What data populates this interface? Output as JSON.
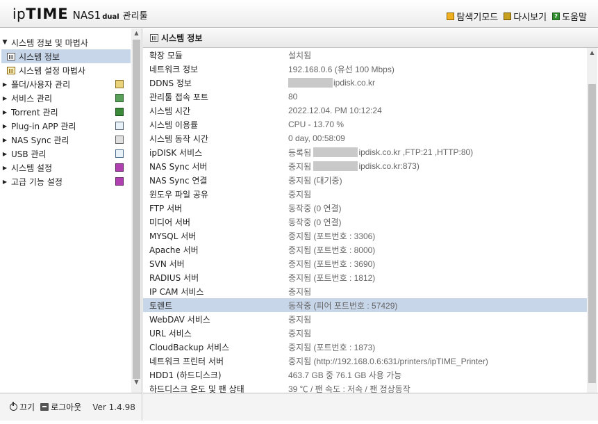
{
  "header": {
    "logo_ip": "ip",
    "logo_time": "TIME",
    "logo_model": "NAS1",
    "logo_dual": "dual",
    "logo_tool": "관리툴",
    "links": [
      {
        "label": "탐색기모드",
        "icon": "explorer-mode-icon"
      },
      {
        "label": "다시보기",
        "icon": "refresh-icon"
      },
      {
        "label": "도움말",
        "icon": "help-icon"
      }
    ]
  },
  "sidebar": {
    "items": [
      {
        "label": "시스템 정보 및 마법사",
        "expanded": true,
        "level": 0
      },
      {
        "label": "시스템 정보",
        "level": 1,
        "selected": true
      },
      {
        "label": "시스템 설정 마법사",
        "level": 1
      },
      {
        "label": "폴더/사용자 관리",
        "level": 0,
        "icon": "folder-user-icon"
      },
      {
        "label": "서비스 관리",
        "level": 0,
        "icon": "service-icon"
      },
      {
        "label": "Torrent 관리",
        "level": 0,
        "icon": "torrent-icon"
      },
      {
        "label": "Plug-in APP 관리",
        "level": 0,
        "icon": "plugin-icon"
      },
      {
        "label": "NAS Sync 관리",
        "level": 0,
        "icon": "nas-sync-icon"
      },
      {
        "label": "USB 관리",
        "level": 0,
        "icon": "usb-icon"
      },
      {
        "label": "시스템 설정",
        "level": 0,
        "icon": "system-settings-icon"
      },
      {
        "label": "고급 기능 설정",
        "level": 0,
        "icon": "advanced-settings-icon"
      }
    ],
    "footer": {
      "power_label": "끄기",
      "logout_label": "로그아웃",
      "version": "Ver 1.4.98"
    }
  },
  "main": {
    "title": "시스템 정보",
    "rows": [
      {
        "label": "확장 모듈",
        "value": "설치됨"
      },
      {
        "label": "네트워크 정보",
        "value": "192.168.0.6 (유선 100 Mbps)"
      },
      {
        "label": "DDNS 정보",
        "value": "ipdisk.co.kr",
        "redacted_prefix": true
      },
      {
        "label": "관리툴 접속 포트",
        "value": "80"
      },
      {
        "label": "시스템 시간",
        "value": "2022.12.04. PM 10:12:24"
      },
      {
        "label": "시스템 이용률",
        "value": "CPU - 13.70 %"
      },
      {
        "label": "시스템 동작 시간",
        "value": "0 day, 00:58:09"
      },
      {
        "label": "ipDISK 서비스",
        "value_prefix": "등록됨",
        "value": "ipdisk.co.kr ,FTP:21 ,HTTP:80)",
        "redacted_prefix": true
      },
      {
        "label": "NAS Sync 서버",
        "value_prefix": "중지됨",
        "value": "ipdisk.co.kr:873)",
        "redacted_prefix": true
      },
      {
        "label": "NAS Sync 연결",
        "value": "중지됨 (대기중)"
      },
      {
        "label": "윈도우 파일 공유",
        "value": "중지됨"
      },
      {
        "label": "FTP 서버",
        "value": "동작중 (0 연결)"
      },
      {
        "label": "미디어 서버",
        "value": "동작중 (0 연결)"
      },
      {
        "label": "MYSQL 서버",
        "value": "중지됨 (포트번호 : 3306)"
      },
      {
        "label": "Apache 서버",
        "value": "중지됨 (포트번호 : 8000)"
      },
      {
        "label": "SVN 서버",
        "value": "중지됨 (포트번호 : 3690)"
      },
      {
        "label": "RADIUS 서버",
        "value": "중지됨 (포트번호 : 1812)"
      },
      {
        "label": "IP CAM 서비스",
        "value": "중지됨"
      },
      {
        "label": "토렌트",
        "value": "동작중 (피어 포트번호 : 57429)",
        "highlight": true
      },
      {
        "label": "WebDAV 서비스",
        "value": "중지됨"
      },
      {
        "label": "URL 서비스",
        "value": "중지됨"
      },
      {
        "label": "CloudBackup 서비스",
        "value": "중지됨 (포트번호 : 1873)"
      },
      {
        "label": "네트워크 프린터 서버",
        "value": "중지됨 (http://192.168.0.6:631/printers/ipTIME_Printer)"
      },
      {
        "label": "HDD1 (하드디스크)",
        "value": "463.7 GB 중 76.1 GB 사용 가능"
      },
      {
        "label": "하드디스크 온도 및 팬 상태",
        "value": "39 ℃ / 팬 속도 : 저속 / 팬 정상동작"
      }
    ]
  }
}
